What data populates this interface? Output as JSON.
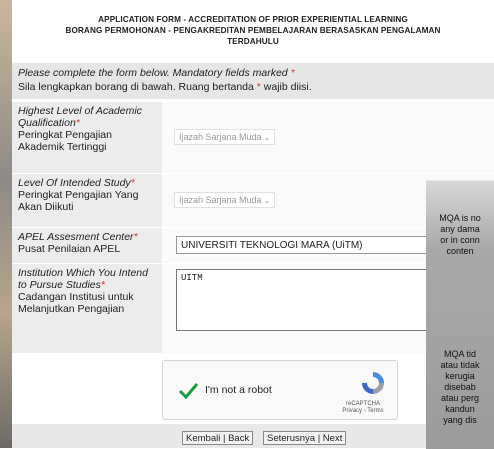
{
  "header": {
    "line1": "APPLICATION FORM - ACCREDITATION OF PRIOR EXPERIENTIAL LEARNING",
    "line2": "BORANG PERMOHONAN - PENGAKREDITAN PEMBELAJARAN BERASASKAN PENGALAMAN",
    "line3": "TERDAHULU"
  },
  "instructions": {
    "en": "Please complete the form below. Mandatory fields marked",
    "ms_prefix": "Sila lengkapkan borang di bawah. Ruang bertanda",
    "ms_suffix": "wajib diisi.",
    "asterisk": "*"
  },
  "fields": {
    "qualification": {
      "label_en": "Highest Level of Academic Qualification",
      "label_ms": "Peringkat Pengajian Akademik Tertinggi",
      "value": "Ijazah Sarjana Muda"
    },
    "study_level": {
      "label_en": "Level Of Intended Study",
      "label_ms": "Peringkat Pengajian Yang Akan Diikuti",
      "value": "Ijazah Sarjana Muda"
    },
    "center": {
      "label_en": "APEL Assesment Center",
      "label_ms": "Pusat Penilaian APEL",
      "value": "UNIVERSITI TEKNOLOGI MARA (UiTM)"
    },
    "institution": {
      "label_en": "Institution Which You Intend to Pursue Studies",
      "label_ms": "Cadangan Institusi untuk Melanjutkan Pengajian",
      "value": "UITM"
    }
  },
  "captcha": {
    "label": "I'm not a robot",
    "brand": "reCAPTCHA",
    "links": "Privacy - Terms"
  },
  "buttons": {
    "back": "Kembali | Back",
    "next": "Seterusnya | Next"
  },
  "overlay_text": {
    "lines_a": [
      "MQA is no",
      "any dama",
      "or in conn",
      "conten"
    ],
    "lines_b": [
      "MQA tid",
      "atau tidak",
      "kerugia",
      "disebab",
      "atau perg",
      "kandun",
      "yang dis"
    ]
  }
}
